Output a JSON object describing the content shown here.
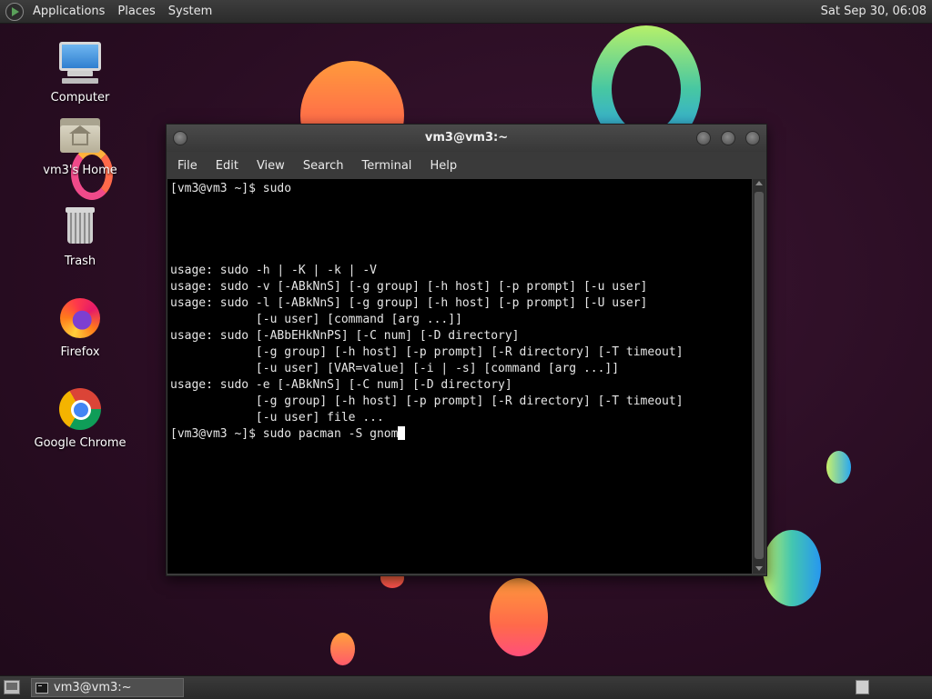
{
  "top_panel": {
    "menus": [
      "Applications",
      "Places",
      "System"
    ],
    "clock": "Sat Sep 30, 06:08"
  },
  "desktop_icons": [
    {
      "label": "Computer",
      "icon": "computer-icon"
    },
    {
      "label": "vm3's Home",
      "icon": "home-folder-icon"
    },
    {
      "label": "Trash",
      "icon": "trash-icon"
    },
    {
      "label": "Firefox",
      "icon": "firefox-icon"
    },
    {
      "label": "Google Chrome",
      "icon": "chrome-icon"
    }
  ],
  "terminal": {
    "title": "vm3@vm3:~",
    "menu": [
      "File",
      "Edit",
      "View",
      "Search",
      "Terminal",
      "Help"
    ],
    "lines": [
      "[vm3@vm3 ~]$ sudo",
      "",
      "",
      "",
      "",
      "usage: sudo -h | -K | -k | -V",
      "usage: sudo -v [-ABkNnS] [-g group] [-h host] [-p prompt] [-u user]",
      "usage: sudo -l [-ABkNnS] [-g group] [-h host] [-p prompt] [-U user]",
      "            [-u user] [command [arg ...]]",
      "usage: sudo [-ABbEHkNnPS] [-C num] [-D directory]",
      "            [-g group] [-h host] [-p prompt] [-R directory] [-T timeout]",
      "            [-u user] [VAR=value] [-i | -s] [command [arg ...]]",
      "usage: sudo -e [-ABkNnS] [-C num] [-D directory]",
      "            [-g group] [-h host] [-p prompt] [-R directory] [-T timeout]",
      "            [-u user] file ..."
    ],
    "current_input": "[vm3@vm3 ~]$ sudo pacman -S gnom"
  },
  "bottom_panel": {
    "task_label": "vm3@vm3:~"
  }
}
